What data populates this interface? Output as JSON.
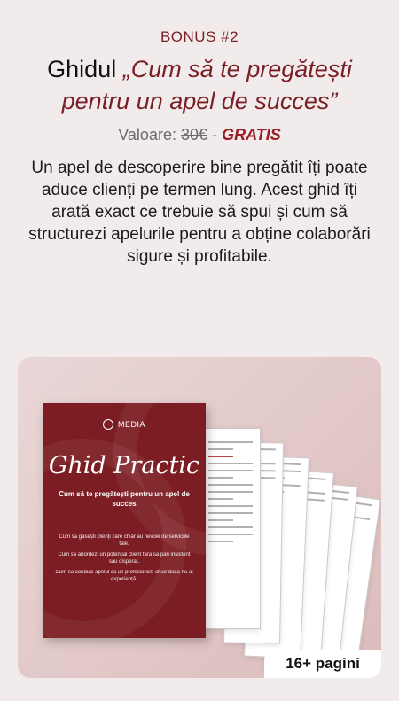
{
  "header": {
    "eyebrow": "BONUS #2",
    "title_plain": "Ghidul ",
    "title_italic": "„Cum să te pregătești pentru un apel de succes”"
  },
  "price": {
    "label": "Valoare:",
    "old": "30€",
    "separator": "-",
    "free": "GRATIS"
  },
  "description": "Un apel de descoperire bine pregătit îți poate aduce clienți pe termen lung. Acest ghid îți arată exact ce trebuie să spui și cum să structurezi apelurile pentru a obține colaborări sigure și profitabile.",
  "mockup": {
    "logo": "MEDIA",
    "book_title": "Ghid Practic",
    "book_subtitle": "Cum să te pregătești pentru un apel de succes",
    "bullets": [
      "Cum să găsești clienți care chiar au nevoie de serviciile tale.",
      "Cum să abordezi un potențial client fără să pari insistent sau disperat.",
      "Cum să conduci apelul ca un profesionist, chiar dacă nu ai experiență."
    ]
  },
  "badge": "16+ pagini",
  "colors": {
    "accent": "#7a1f25",
    "background": "#f1eceb",
    "book": "#7c1d23"
  }
}
